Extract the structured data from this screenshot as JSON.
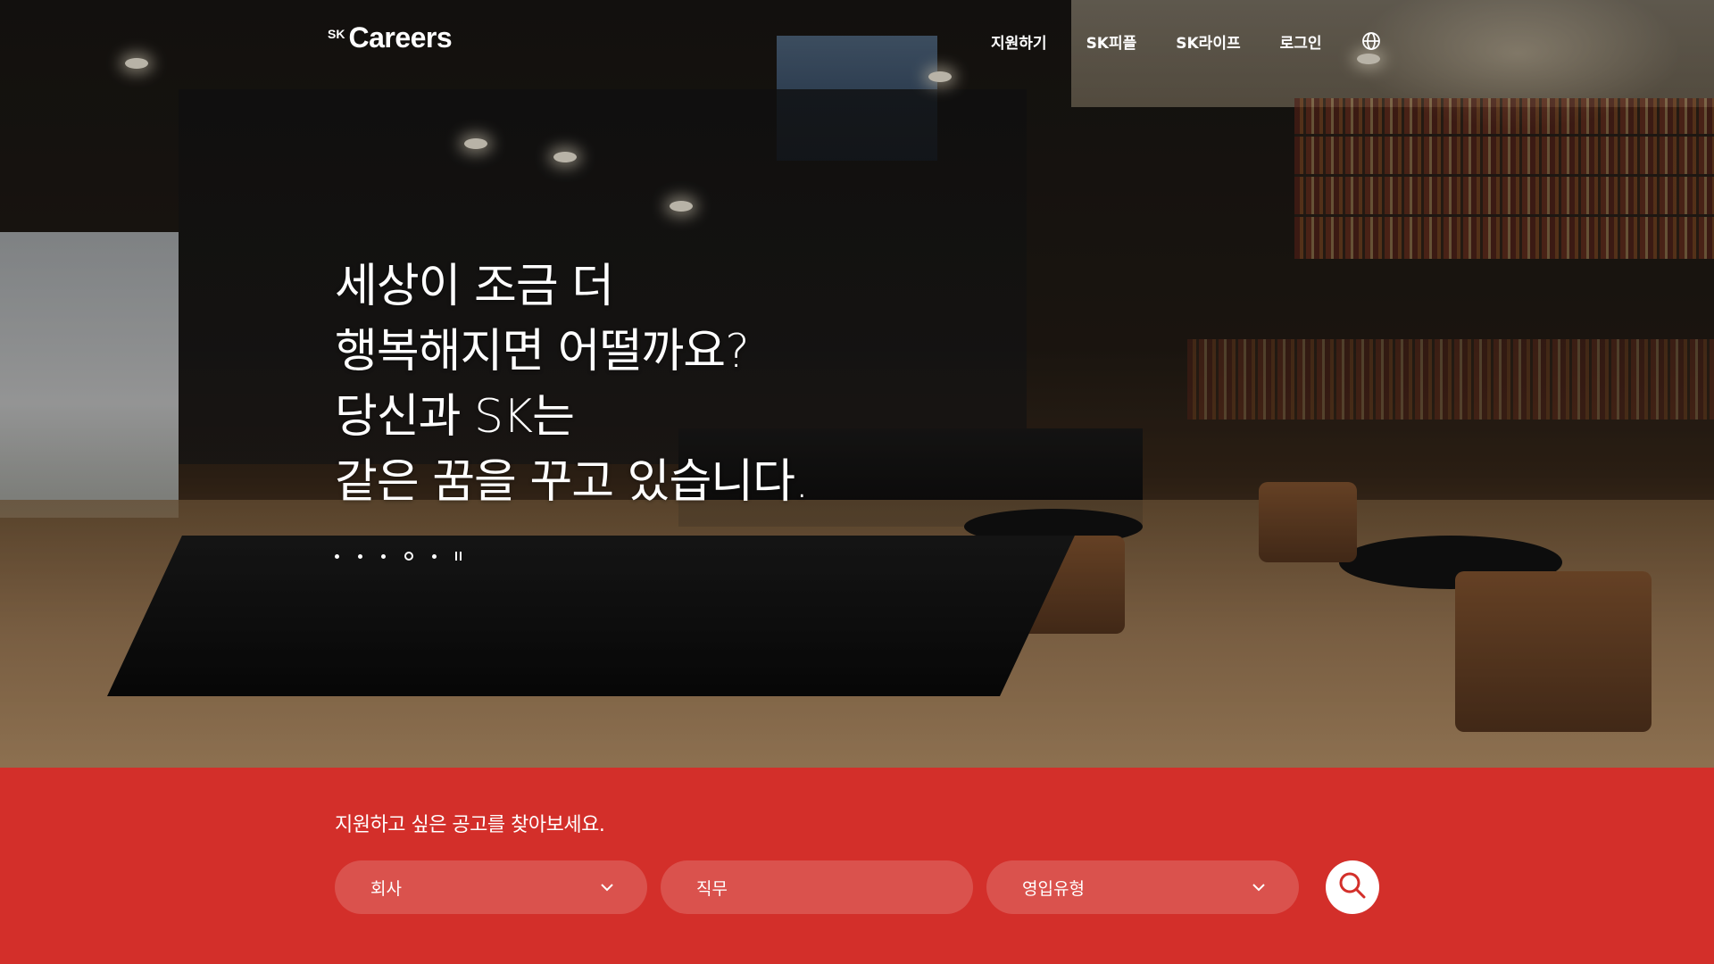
{
  "header": {
    "logo_prefix": "SK",
    "logo_word": "Careers",
    "nav": [
      {
        "label": "지원하기"
      },
      {
        "label": "SK피플"
      },
      {
        "label": "SK라이프"
      },
      {
        "label": "로그인"
      }
    ],
    "language_icon": "globe-icon"
  },
  "hero": {
    "headline": [
      "세상이 조금 더",
      "행복해지면 어떨까요?",
      "당신과 SK는",
      "같은 꿈을 꾸고 있습니다."
    ],
    "slides": {
      "count": 5,
      "active_index": 3
    },
    "pause_icon": "pause-icon"
  },
  "search": {
    "title": "지원하고 싶은 공고를 찾아보세요.",
    "fields": [
      {
        "label": "회사",
        "dropdown": true
      },
      {
        "label": "직무",
        "dropdown": false
      },
      {
        "label": "영입유형",
        "dropdown": true
      }
    ],
    "search_icon": "search-icon"
  },
  "colors": {
    "band_background": "#d32f2a",
    "field_background": "rgba(255,255,255,0.17)",
    "text": "#ffffff",
    "search_icon": "#d32f2a"
  }
}
